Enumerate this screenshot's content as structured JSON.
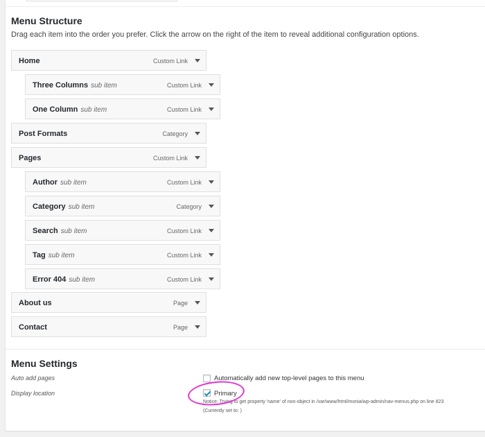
{
  "menu_structure": {
    "title": "Menu Structure",
    "instructions": "Drag each item into the order you prefer. Click the arrow on the right of the item to reveal additional configuration options.",
    "sub_item_tag": "sub item",
    "items": [
      {
        "label": "Home",
        "type": "Custom Link",
        "sub": false
      },
      {
        "label": "Three Columns",
        "type": "Custom Link",
        "sub": true
      },
      {
        "label": "One Column",
        "type": "Custom Link",
        "sub": true
      },
      {
        "label": "Post Formats",
        "type": "Category",
        "sub": false
      },
      {
        "label": "Pages",
        "type": "Custom Link",
        "sub": false
      },
      {
        "label": "Author",
        "type": "Custom Link",
        "sub": true
      },
      {
        "label": "Category",
        "type": "Category",
        "sub": true
      },
      {
        "label": "Search",
        "type": "Custom Link",
        "sub": true
      },
      {
        "label": "Tag",
        "type": "Custom Link",
        "sub": true
      },
      {
        "label": "Error 404",
        "type": "Custom Link",
        "sub": true
      },
      {
        "label": "About us",
        "type": "Page",
        "sub": false
      },
      {
        "label": "Contact",
        "type": "Page",
        "sub": false
      }
    ]
  },
  "menu_settings": {
    "title": "Menu Settings",
    "auto_add_label": "Auto add pages",
    "auto_add_option": "Automatically add new top-level pages to this menu",
    "auto_add_checked": false,
    "display_location_label": "Display location",
    "location_option": "Primary",
    "location_checked": true,
    "notice": "Notice: Trying to get property 'name' of non-object in /var/www/html/monia/wp-admin/nav-menus.php on line 823",
    "currently_set": "(Currently set to: )"
  },
  "colors": {
    "highlight_ring": "#e331d4",
    "checkmark": "#1e8cbe"
  }
}
